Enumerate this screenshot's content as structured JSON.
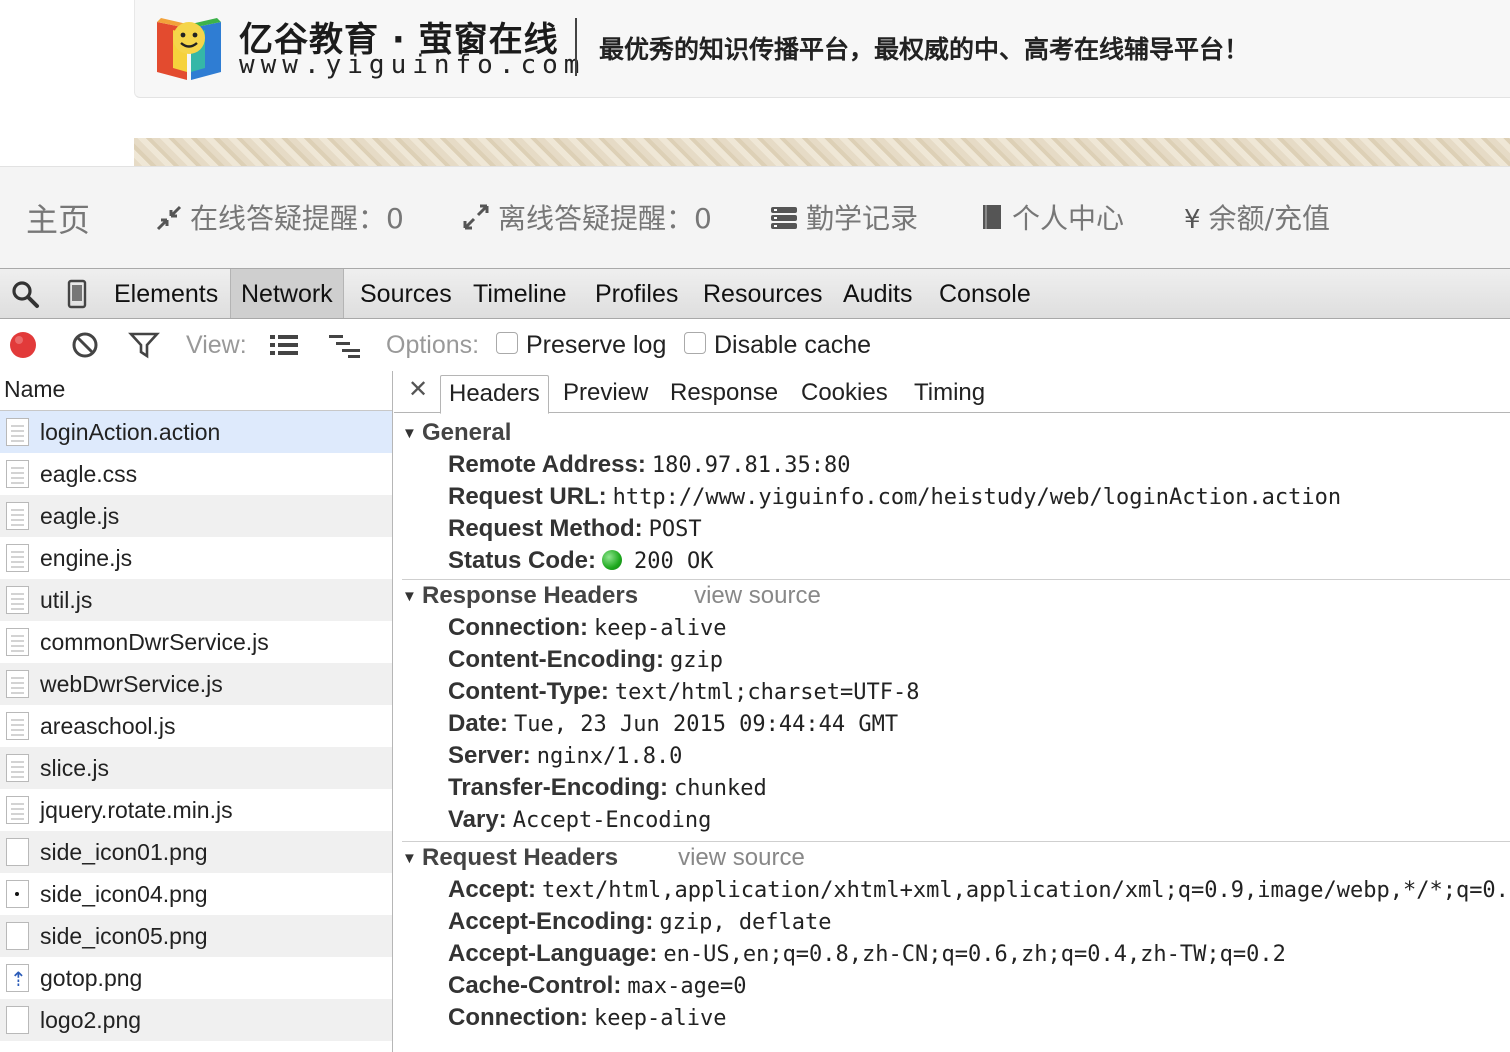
{
  "site": {
    "logo_title": "亿谷教育 · 萤窗在线",
    "logo_url": "www.yiguinfo.com",
    "slogan": "最优秀的知识传播平台，最权威的中、高考在线辅导平台！",
    "nav": {
      "home": "主页",
      "online_qa": "在线答疑提醒：0",
      "offline_qa": "离线答疑提醒：0",
      "study_log": "勤学记录",
      "personal": "个人中心",
      "balance": "余额/充值",
      "yen_glyph": "¥"
    }
  },
  "devtools": {
    "tabs": [
      "Elements",
      "Network",
      "Sources",
      "Timeline",
      "Profiles",
      "Resources",
      "Audits",
      "Console"
    ],
    "active_tab": "Network",
    "toolbar": {
      "view_label": "View:",
      "options_label": "Options:",
      "preserve_log": "Preserve log",
      "disable_cache": "Disable cache"
    },
    "name_header": "Name",
    "requests": [
      {
        "name": "loginAction.action",
        "icon": "doc"
      },
      {
        "name": "eagle.css",
        "icon": "doc"
      },
      {
        "name": "eagle.js",
        "icon": "doc"
      },
      {
        "name": "engine.js",
        "icon": "doc"
      },
      {
        "name": "util.js",
        "icon": "doc"
      },
      {
        "name": "commonDwrService.js",
        "icon": "doc"
      },
      {
        "name": "webDwrService.js",
        "icon": "doc"
      },
      {
        "name": "areaschool.js",
        "icon": "doc"
      },
      {
        "name": "slice.js",
        "icon": "doc"
      },
      {
        "name": "jquery.rotate.min.js",
        "icon": "doc"
      },
      {
        "name": "side_icon01.png",
        "icon": "blank"
      },
      {
        "name": "side_icon04.png",
        "icon": "dot"
      },
      {
        "name": "side_icon05.png",
        "icon": "blank"
      },
      {
        "name": "gotop.png",
        "icon": "arrow"
      },
      {
        "name": "logo2.png",
        "icon": "blank"
      }
    ],
    "detail_tabs": [
      "Headers",
      "Preview",
      "Response",
      "Cookies",
      "Timing"
    ],
    "active_detail_tab": "Headers",
    "view_source": "view source",
    "general": {
      "title": "General",
      "rows": [
        {
          "key": "Remote Address:",
          "value": "180.97.81.35:80"
        },
        {
          "key": "Request URL:",
          "value": "http://www.yiguinfo.com/heistudy/web/loginAction.action"
        },
        {
          "key": "Request Method:",
          "value": "POST"
        },
        {
          "key": "Status Code:",
          "value": "200 OK"
        }
      ]
    },
    "response_headers": {
      "title": "Response Headers",
      "rows": [
        {
          "key": "Connection:",
          "value": "keep-alive"
        },
        {
          "key": "Content-Encoding:",
          "value": "gzip"
        },
        {
          "key": "Content-Type:",
          "value": "text/html;charset=UTF-8"
        },
        {
          "key": "Date:",
          "value": "Tue, 23 Jun 2015 09:44:44 GMT"
        },
        {
          "key": "Server:",
          "value": "nginx/1.8.0"
        },
        {
          "key": "Transfer-Encoding:",
          "value": "chunked"
        },
        {
          "key": "Vary:",
          "value": "Accept-Encoding"
        }
      ]
    },
    "request_headers": {
      "title": "Request Headers",
      "rows": [
        {
          "key": "Accept:",
          "value": "text/html,application/xhtml+xml,application/xml;q=0.9,image/webp,*/*;q=0."
        },
        {
          "key": "Accept-Encoding:",
          "value": "gzip, deflate"
        },
        {
          "key": "Accept-Language:",
          "value": "en-US,en;q=0.8,zh-CN;q=0.6,zh;q=0.4,zh-TW;q=0.2"
        },
        {
          "key": "Cache-Control:",
          "value": "max-age=0"
        },
        {
          "key": "Connection:",
          "value": "keep-alive"
        }
      ]
    },
    "colors": {
      "record": "#e23a3a",
      "selected_row": "#deeafc",
      "status_ok": "#1ea91e"
    }
  }
}
